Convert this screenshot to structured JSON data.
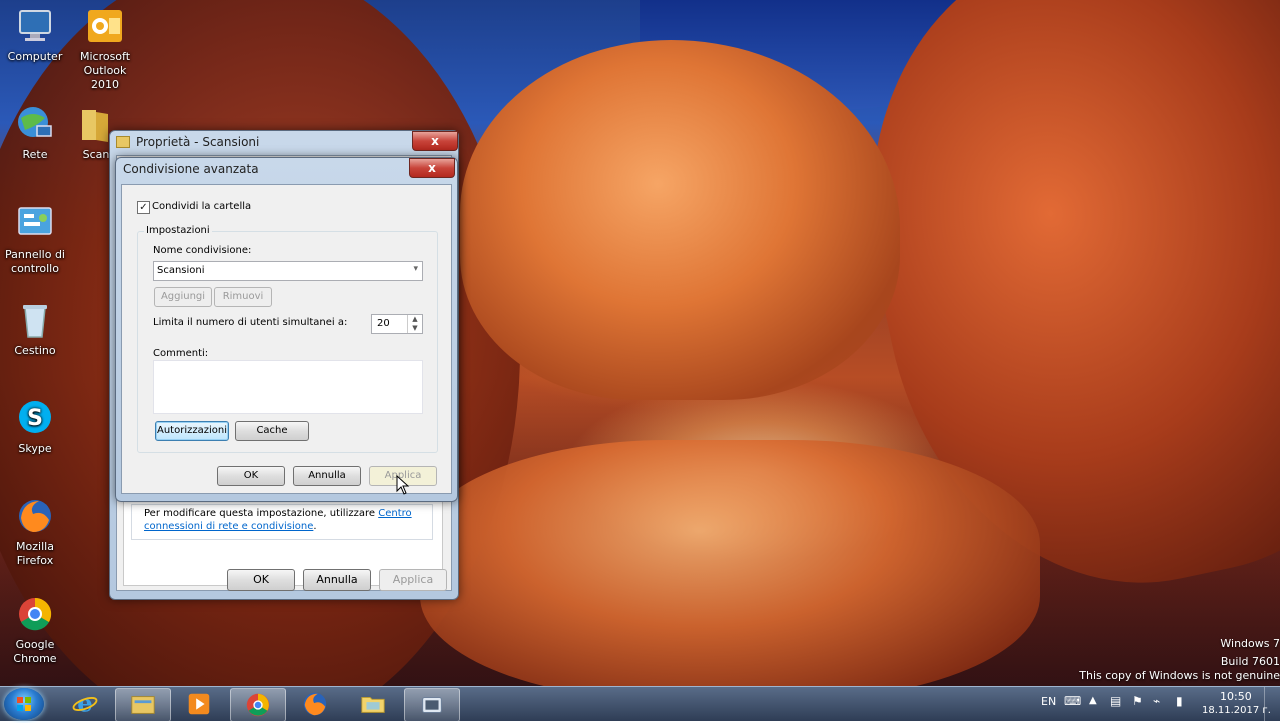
{
  "desktop": {
    "icons": [
      {
        "label": "Computer",
        "icon": "computer-icon"
      },
      {
        "label": "Microsoft Outlook 2010",
        "icon": "outlook-icon"
      },
      {
        "label": "Rete",
        "icon": "network-icon"
      },
      {
        "label": "Scan",
        "icon": "folder-icon"
      },
      {
        "label": "Pannello di controllo",
        "icon": "control-panel-icon"
      },
      {
        "label": "Cestino",
        "icon": "recycle-bin-icon"
      },
      {
        "label": "Skype",
        "icon": "skype-icon"
      },
      {
        "label": "Mozilla Firefox",
        "icon": "firefox-icon"
      },
      {
        "label": "Google Chrome",
        "icon": "chrome-icon"
      }
    ],
    "watermark": {
      "line1": "Windows 7",
      "line2": "Build 7601",
      "line3": "This copy of Windows is not genuine"
    }
  },
  "properties_window": {
    "title": "Proprietà - Scansioni",
    "close_label": "x",
    "info_text": "Per modificare questa impostazione, utilizzare",
    "info_link": "Centro connessioni di rete e condivisione",
    "info_link_end": ".",
    "ok_label": "OK",
    "cancel_label": "Annulla",
    "apply_label": "Applica"
  },
  "advanced_dialog": {
    "title": "Condivisione avanzata",
    "close_label": "x",
    "share_checkbox_label": "Condividi la cartella",
    "share_checked": true,
    "settings_group": "Impostazioni",
    "share_name_label": "Nome condivisione:",
    "share_name_value": "Scansioni",
    "add_label": "Aggiungi",
    "remove_label": "Rimuovi",
    "limit_label": "Limita il numero di utenti simultanei a:",
    "limit_value": "20",
    "comments_label": "Commenti:",
    "comments_value": "",
    "permissions_label": "Autorizzazioni",
    "cache_label": "Cache",
    "ok_label": "OK",
    "cancel_label": "Annulla",
    "apply_label": "Applica"
  },
  "taskbar": {
    "items": [
      {
        "name": "internet-explorer"
      },
      {
        "name": "windows-explorer"
      },
      {
        "name": "media-player"
      },
      {
        "name": "google-chrome"
      },
      {
        "name": "mozilla-firefox"
      },
      {
        "name": "folder"
      },
      {
        "name": "video-capture"
      }
    ],
    "language": "EN",
    "time": "10:50",
    "date": "18.11.2017 г."
  }
}
